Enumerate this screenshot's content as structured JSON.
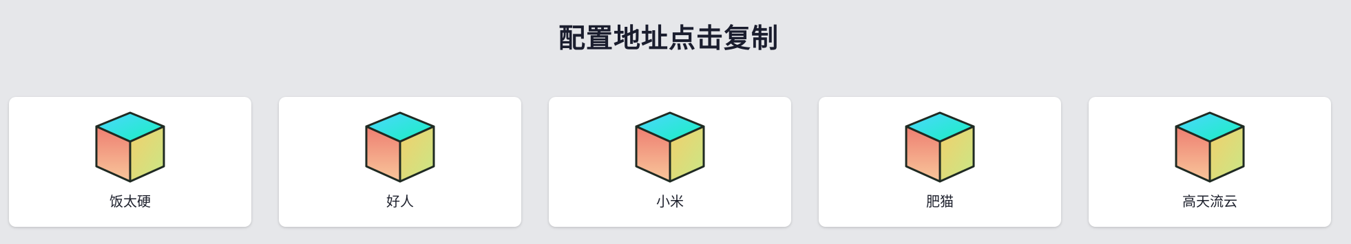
{
  "header": {
    "title": "配置地址点击复制"
  },
  "cards": [
    {
      "label": "饭太硬",
      "icon": "cube-icon"
    },
    {
      "label": "好人",
      "icon": "cube-icon"
    },
    {
      "label": "小米",
      "icon": "cube-icon"
    },
    {
      "label": "肥猫",
      "icon": "cube-icon"
    },
    {
      "label": "高天流云",
      "icon": "cube-icon"
    }
  ],
  "colors": {
    "background": "#e6e7ea",
    "card": "#ffffff",
    "cube_top_start": "#4dd7ff",
    "cube_top_end": "#18f0c0",
    "cube_left_start": "#ee7e71",
    "cube_left_end": "#f8c79b",
    "cube_right_start": "#f2cf6c",
    "cube_right_end": "#c8e887",
    "cube_outline": "#1f2a22"
  }
}
